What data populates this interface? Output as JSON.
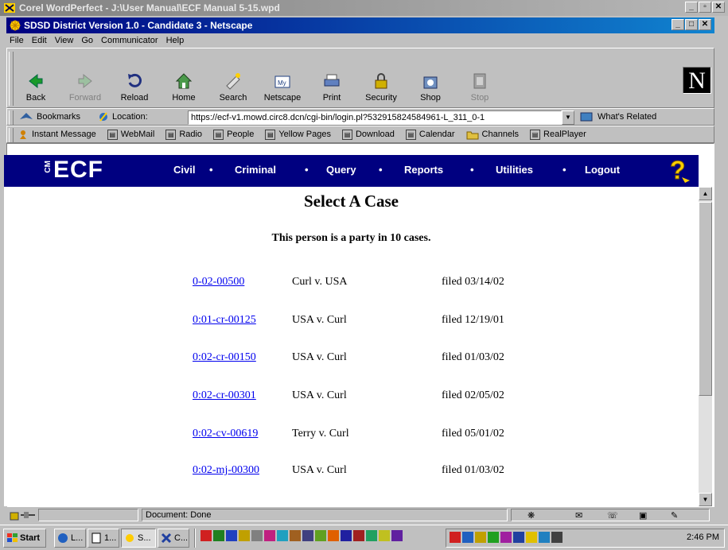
{
  "wp_window": {
    "title": "Corel WordPerfect - J:\\User Manual\\ECF Manual 5-15.wpd"
  },
  "ns_window": {
    "title": "SDSD District Version 1.0 - Candidate 3 - Netscape"
  },
  "menu": [
    "File",
    "Edit",
    "View",
    "Go",
    "Communicator",
    "Help"
  ],
  "toolbar": [
    "Back",
    "Forward",
    "Reload",
    "Home",
    "Search",
    "Netscape",
    "Print",
    "Security",
    "Shop",
    "Stop"
  ],
  "location": {
    "bookmarks": "Bookmarks",
    "label": "Location:",
    "url": "https://ecf-v1.mowd.circ8.dcn/cgi-bin/login.pl?5329158245849​61-L_311_0-1",
    "related": "What's Related"
  },
  "personal": [
    "Instant Message",
    "WebMail",
    "Radio",
    "People",
    "Yellow Pages",
    "Download",
    "Calendar",
    "Channels",
    "RealPlayer"
  ],
  "ecf": {
    "logo": "ECF",
    "logo_small": "CM",
    "nav": [
      "Civil",
      "Criminal",
      "Query",
      "Reports",
      "Utilities",
      "Logout"
    ]
  },
  "page": {
    "title": "Select A Case",
    "subtitle": "This person is a party in 10 cases.",
    "cases": [
      {
        "number": "0-02-00500",
        "parties": "Curl v. USA",
        "filed": "filed 03/14/02"
      },
      {
        "number": "0:01-cr-00125",
        "parties": "USA v. Curl",
        "filed": "filed 12/19/01"
      },
      {
        "number": "0:02-cr-00150",
        "parties": "USA v. Curl",
        "filed": "filed 01/03/02"
      },
      {
        "number": "0:02-cr-00301",
        "parties": "USA v. Curl",
        "filed": "filed 02/05/02"
      },
      {
        "number": "0:02-cv-00619",
        "parties": "Terry v. Curl",
        "filed": "filed 05/01/02"
      },
      {
        "number": "0:02-mj-00300",
        "parties": "USA v. Curl",
        "filed": "filed 01/03/02"
      }
    ]
  },
  "status": "Document: Done",
  "taskbar": {
    "start": "Start",
    "tasks": [
      "L...",
      "1...",
      "S...",
      "C..."
    ],
    "clock": "2:46 PM"
  }
}
